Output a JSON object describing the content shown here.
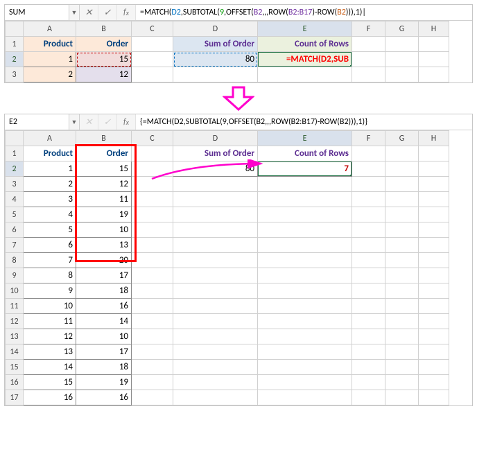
{
  "top": {
    "namebox": "SUM",
    "formula_html": "=MATCH(<span class='r1'>D2</span>,SUBTOTAL(<span class='r2'>9</span>,OFFSET(<span class='r3'>B2</span>,,,ROW(<span class='r4'>B2:B17</span>)-ROW(<span class='r5'>B2</span>))),1)|",
    "cols": [
      "",
      "A",
      "B",
      "C",
      "D",
      "E",
      "F",
      "G",
      "H"
    ],
    "headers": {
      "A": "Product",
      "B": "Order",
      "D": "Sum of Order",
      "E": "Count of Rows"
    },
    "rows": [
      {
        "n": 1
      },
      {
        "n": 2,
        "A": "1",
        "B": "15",
        "D": "80",
        "E": "=MATCH(D2,SUB"
      },
      {
        "n": 3,
        "A": "2",
        "B": "12"
      }
    ]
  },
  "bottom": {
    "namebox": "E2",
    "formula": "{=MATCH(D2,SUBTOTAL(9,OFFSET(B2,,,ROW(B2:B17)-ROW(B2))),1)}",
    "cols": [
      "",
      "A",
      "B",
      "C",
      "D",
      "E",
      "F",
      "G",
      "H"
    ],
    "headers": {
      "A": "Product",
      "B": "Order",
      "D": "Sum of Order",
      "E": "Count of Rows"
    },
    "D2": "80",
    "E2": "7",
    "data": [
      [
        "1",
        "15"
      ],
      [
        "2",
        "12"
      ],
      [
        "3",
        "11"
      ],
      [
        "4",
        "19"
      ],
      [
        "5",
        "10"
      ],
      [
        "6",
        "13"
      ],
      [
        "7",
        "20"
      ],
      [
        "8",
        "17"
      ],
      [
        "9",
        "18"
      ],
      [
        "10",
        "16"
      ],
      [
        "11",
        "14"
      ],
      [
        "12",
        "10"
      ],
      [
        "13",
        "17"
      ],
      [
        "14",
        "18"
      ],
      [
        "15",
        "19"
      ],
      [
        "16",
        "16"
      ]
    ]
  }
}
